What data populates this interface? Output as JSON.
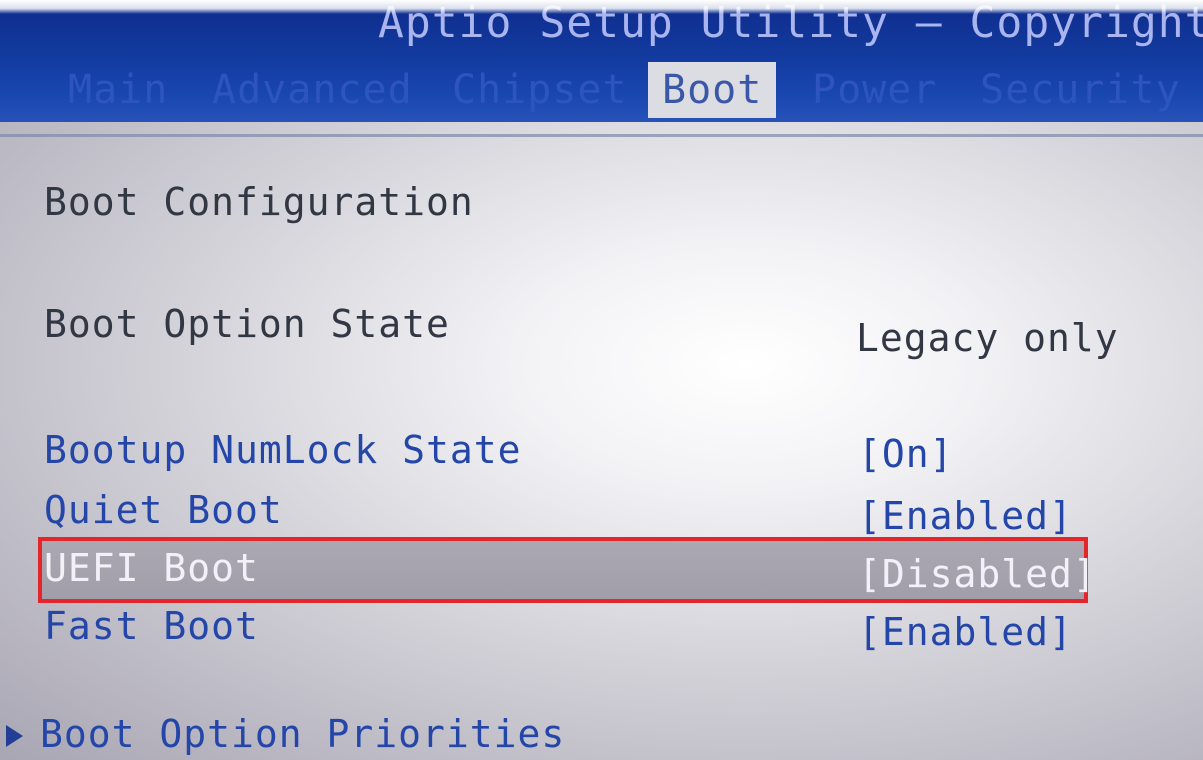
{
  "header": {
    "title": "Aptio Setup Utility – Copyright (C"
  },
  "tabs": [
    {
      "label": "Main"
    },
    {
      "label": "Advanced"
    },
    {
      "label": "Chipset"
    },
    {
      "label": "Boot"
    },
    {
      "label": "Power"
    },
    {
      "label": "Security"
    }
  ],
  "active_tab": "Boot",
  "section": {
    "title": "Boot Configuration"
  },
  "boot_option_state": {
    "label": "Boot Option State",
    "value": "Legacy only"
  },
  "settings": [
    {
      "label": "Bootup NumLock State",
      "value": "[On]"
    },
    {
      "label": "Quiet Boot",
      "value": "[Enabled]"
    },
    {
      "label": "UEFI Boot",
      "value": "[Disabled]"
    },
    {
      "label": "Fast Boot",
      "value": "[Enabled]"
    }
  ],
  "submenu": {
    "label": "Boot Option Priorities",
    "icon": "triangle-right-icon"
  },
  "colors": {
    "header_bg": "#123a9e",
    "option_text": "#2446a8",
    "highlight_border": "#e4262b",
    "selected_text": "#f2f1f7"
  }
}
